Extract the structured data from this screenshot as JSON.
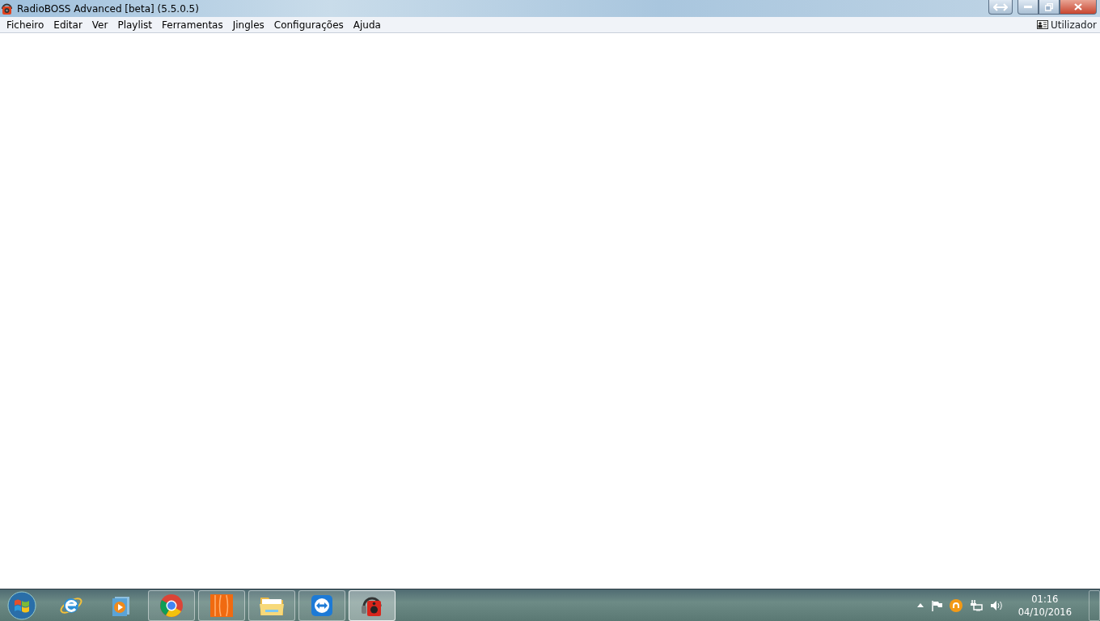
{
  "window": {
    "title": "RadioBOSS Advanced [beta] (5.5.0.5)"
  },
  "menu": [
    {
      "label": "Ficheiro"
    },
    {
      "label": "Editar"
    },
    {
      "label": "Ver"
    },
    {
      "label": "Playlist"
    },
    {
      "label": "Ferramentas"
    },
    {
      "label": "Jingles"
    },
    {
      "label": "Configurações"
    },
    {
      "label": "Ajuda"
    }
  ],
  "user": {
    "label": "Utilizador"
  },
  "taskbar": {
    "apps": [
      {
        "kind": "ie",
        "running": false,
        "selected": false
      },
      {
        "kind": "media",
        "running": false,
        "selected": false
      },
      {
        "kind": "chrome",
        "running": true,
        "selected": false
      },
      {
        "kind": "orange",
        "running": true,
        "selected": false
      },
      {
        "kind": "folder",
        "running": true,
        "selected": false
      },
      {
        "kind": "remote",
        "running": true,
        "selected": false
      },
      {
        "kind": "speaker",
        "running": true,
        "selected": true
      }
    ],
    "clock": {
      "time": "01:16",
      "date": "04/10/2016"
    }
  }
}
